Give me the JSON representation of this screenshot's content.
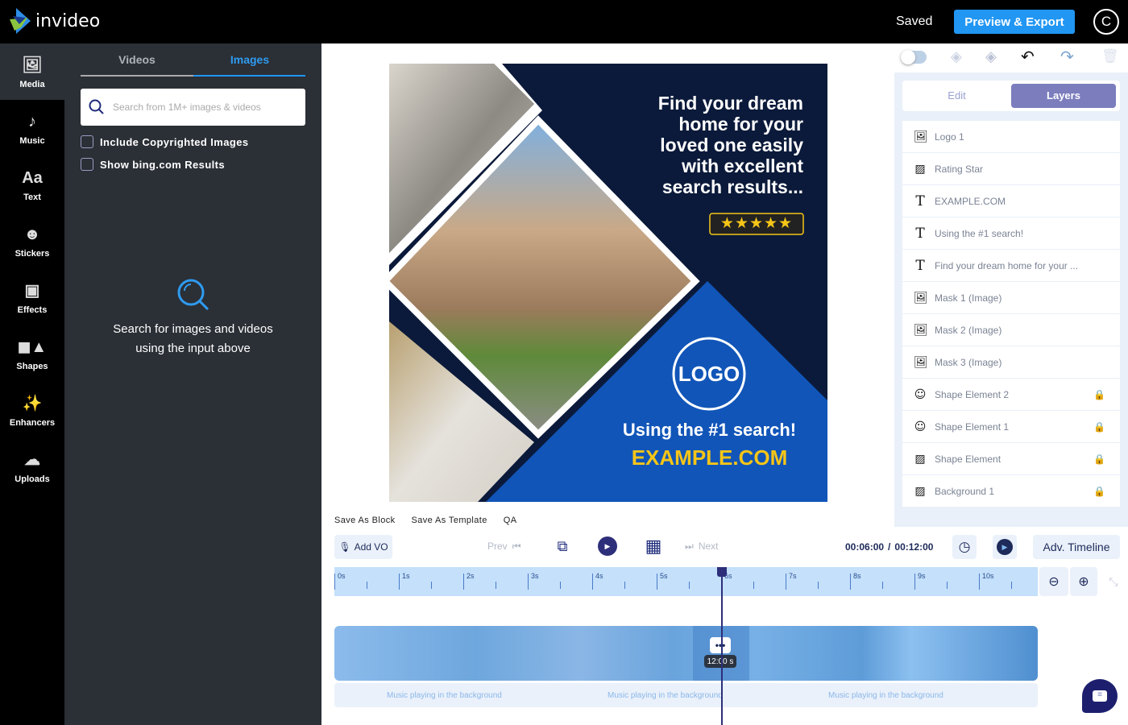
{
  "header": {
    "brand": "invideo",
    "saved": "Saved",
    "export_label": "Preview & Export",
    "avatar_initial": "C"
  },
  "rail": [
    {
      "label": "Media",
      "icon": "media-icon"
    },
    {
      "label": "Music",
      "icon": "music-icon"
    },
    {
      "label": "Text",
      "icon": "text-icon",
      "glyph": "Aa"
    },
    {
      "label": "Stickers",
      "icon": "sticker-icon"
    },
    {
      "label": "Effects",
      "icon": "effects-icon"
    },
    {
      "label": "Shapes",
      "icon": "shapes-icon"
    },
    {
      "label": "Enhancers",
      "icon": "wand-icon"
    },
    {
      "label": "Uploads",
      "icon": "upload-icon"
    }
  ],
  "panel": {
    "tabs": [
      {
        "label": "Videos",
        "active": false
      },
      {
        "label": "Images",
        "active": true
      }
    ],
    "search_placeholder": "Search from 1M+ images & videos",
    "checks": [
      {
        "label": "Include Copyrighted Images",
        "checked": false
      },
      {
        "label": "Show bing.com Results",
        "checked": false
      }
    ],
    "empty_line1": "Search for images and videos",
    "empty_line2": "using the input above"
  },
  "canvas": {
    "headline": [
      "Find your dream",
      "home for your",
      "loved one easily",
      "with excellent",
      "search results..."
    ],
    "stars": "★★★★★",
    "logo": "LOGO",
    "tagline": "Using the #1 search!",
    "website": "EXAMPLE.COM",
    "colors": {
      "navy": "#0b1a3a",
      "blue": "#1155b8",
      "yellow": "#f5c518"
    }
  },
  "right_panel": {
    "tabs": [
      {
        "label": "Edit",
        "active": false
      },
      {
        "label": "Layers",
        "active": true
      }
    ],
    "layers": [
      {
        "name": "Logo 1",
        "type": "image",
        "locked": false
      },
      {
        "name": "Rating Star",
        "type": "shape",
        "locked": false
      },
      {
        "name": "EXAMPLE.COM",
        "type": "text",
        "locked": false
      },
      {
        "name": "Using the #1 search!",
        "type": "text",
        "locked": false
      },
      {
        "name": "Find your dream home for your ...",
        "type": "text",
        "locked": false
      },
      {
        "name": "Mask 1 (Image)",
        "type": "image",
        "locked": false
      },
      {
        "name": "Mask 2 (Image)",
        "type": "image",
        "locked": false
      },
      {
        "name": "Mask 3 (Image)",
        "type": "image",
        "locked": false
      },
      {
        "name": "Shape Element 2",
        "type": "sticker",
        "locked": true
      },
      {
        "name": "Shape Element 1",
        "type": "sticker",
        "locked": true
      },
      {
        "name": "Shape Element",
        "type": "shape",
        "locked": true
      },
      {
        "name": "Background 1",
        "type": "shape",
        "locked": true
      }
    ]
  },
  "timeline": {
    "links": [
      "Save As Block",
      "Save As Template",
      "QA"
    ],
    "add_vo": "Add VO",
    "prev": "Prev",
    "next": "Next",
    "current": "00:06:00",
    "total": "00:12:00",
    "separator": "/",
    "adv": "Adv. Timeline",
    "ticks": [
      "0s",
      "1s",
      "2s",
      "3s",
      "4s",
      "5s",
      "6s",
      "7s",
      "8s",
      "9s",
      "10s"
    ],
    "clip_duration": "12:00 s",
    "playhead_seconds": 6,
    "music": [
      "Music playing in the background",
      "Music playing in the background",
      "Music playing in the background"
    ]
  }
}
